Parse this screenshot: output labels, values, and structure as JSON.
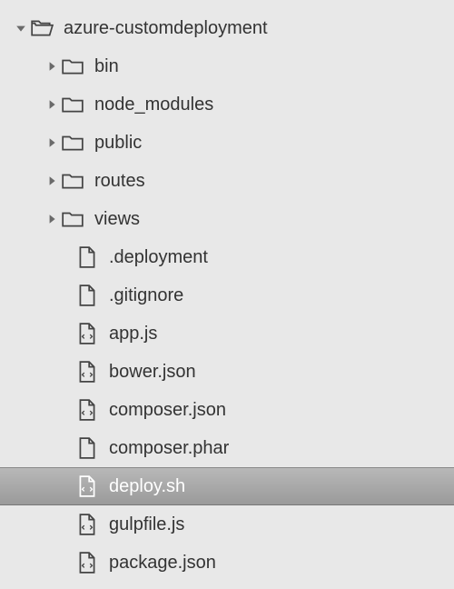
{
  "tree": {
    "root": {
      "name": "azure-customdeployment",
      "expanded": true
    },
    "folders": [
      {
        "name": "bin",
        "expanded": false
      },
      {
        "name": "node_modules",
        "expanded": false
      },
      {
        "name": "public",
        "expanded": false
      },
      {
        "name": "routes",
        "expanded": false
      },
      {
        "name": "views",
        "expanded": false
      }
    ],
    "files": [
      {
        "name": ".deployment",
        "type": "plain",
        "selected": false
      },
      {
        "name": ".gitignore",
        "type": "plain",
        "selected": false
      },
      {
        "name": "app.js",
        "type": "code",
        "selected": false
      },
      {
        "name": "bower.json",
        "type": "code",
        "selected": false
      },
      {
        "name": "composer.json",
        "type": "code",
        "selected": false
      },
      {
        "name": "composer.phar",
        "type": "plain",
        "selected": false
      },
      {
        "name": "deploy.sh",
        "type": "code",
        "selected": true
      },
      {
        "name": "gulpfile.js",
        "type": "code",
        "selected": false
      },
      {
        "name": "package.json",
        "type": "code",
        "selected": false
      }
    ]
  }
}
